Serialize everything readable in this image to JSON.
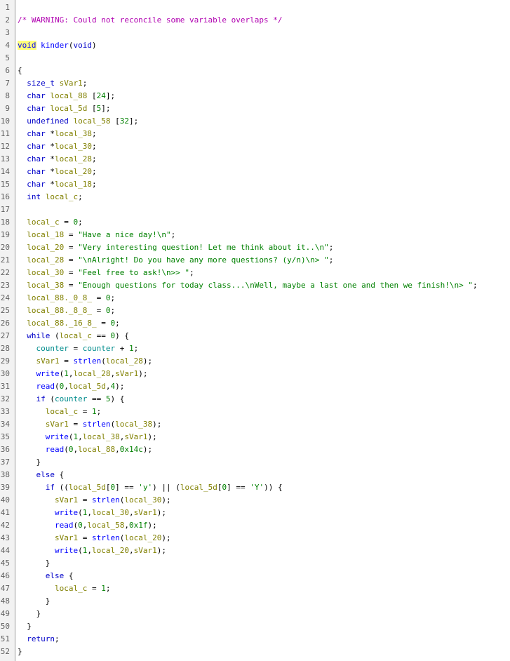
{
  "colors": {
    "comment": "#b000b0",
    "keyword": "#0000c8",
    "function": "#0000ff",
    "variable": "#808000",
    "global": "#008c8c",
    "string": "#008000",
    "highlight": "#ffff7a",
    "gutter_bg": "#f2f2f2",
    "line_number": "#5f5f5f"
  },
  "lines": [
    [],
    [
      [
        "cm",
        "/* WARNING: Could not reconcile some variable overlaps */"
      ]
    ],
    [],
    [
      [
        "fn-hl",
        "void"
      ],
      [
        "pn",
        " "
      ],
      [
        "fn",
        "kinder"
      ],
      [
        "pn",
        "("
      ],
      [
        "ty",
        "void"
      ],
      [
        "pn",
        ")"
      ]
    ],
    [],
    [
      [
        "pn",
        "{"
      ]
    ],
    [
      [
        "pn",
        "  "
      ],
      [
        "ty",
        "size_t"
      ],
      [
        "pn",
        " "
      ],
      [
        "var",
        "sVar1"
      ],
      [
        "pn",
        ";"
      ]
    ],
    [
      [
        "pn",
        "  "
      ],
      [
        "ty",
        "char"
      ],
      [
        "pn",
        " "
      ],
      [
        "var",
        "local_88"
      ],
      [
        "pn",
        " ["
      ],
      [
        "num",
        "24"
      ],
      [
        "pn",
        "];"
      ]
    ],
    [
      [
        "pn",
        "  "
      ],
      [
        "ty",
        "char"
      ],
      [
        "pn",
        " "
      ],
      [
        "var",
        "local_5d"
      ],
      [
        "pn",
        " ["
      ],
      [
        "num",
        "5"
      ],
      [
        "pn",
        "];"
      ]
    ],
    [
      [
        "pn",
        "  "
      ],
      [
        "ty",
        "undefined"
      ],
      [
        "pn",
        " "
      ],
      [
        "var",
        "local_58"
      ],
      [
        "pn",
        " ["
      ],
      [
        "num",
        "32"
      ],
      [
        "pn",
        "];"
      ]
    ],
    [
      [
        "pn",
        "  "
      ],
      [
        "ty",
        "char"
      ],
      [
        "pn",
        " *"
      ],
      [
        "var",
        "local_38"
      ],
      [
        "pn",
        ";"
      ]
    ],
    [
      [
        "pn",
        "  "
      ],
      [
        "ty",
        "char"
      ],
      [
        "pn",
        " *"
      ],
      [
        "var",
        "local_30"
      ],
      [
        "pn",
        ";"
      ]
    ],
    [
      [
        "pn",
        "  "
      ],
      [
        "ty",
        "char"
      ],
      [
        "pn",
        " *"
      ],
      [
        "var",
        "local_28"
      ],
      [
        "pn",
        ";"
      ]
    ],
    [
      [
        "pn",
        "  "
      ],
      [
        "ty",
        "char"
      ],
      [
        "pn",
        " *"
      ],
      [
        "var",
        "local_20"
      ],
      [
        "pn",
        ";"
      ]
    ],
    [
      [
        "pn",
        "  "
      ],
      [
        "ty",
        "char"
      ],
      [
        "pn",
        " *"
      ],
      [
        "var",
        "local_18"
      ],
      [
        "pn",
        ";"
      ]
    ],
    [
      [
        "pn",
        "  "
      ],
      [
        "ty",
        "int"
      ],
      [
        "pn",
        " "
      ],
      [
        "var",
        "local_c"
      ],
      [
        "pn",
        ";"
      ]
    ],
    [],
    [
      [
        "pn",
        "  "
      ],
      [
        "var",
        "local_c"
      ],
      [
        "pn",
        " = "
      ],
      [
        "num",
        "0"
      ],
      [
        "pn",
        ";"
      ]
    ],
    [
      [
        "pn",
        "  "
      ],
      [
        "var",
        "local_18"
      ],
      [
        "pn",
        " = "
      ],
      [
        "str",
        "\"Have a nice day!\\n\""
      ],
      [
        "pn",
        ";"
      ]
    ],
    [
      [
        "pn",
        "  "
      ],
      [
        "var",
        "local_20"
      ],
      [
        "pn",
        " = "
      ],
      [
        "str",
        "\"Very interesting question! Let me think about it..\\n\""
      ],
      [
        "pn",
        ";"
      ]
    ],
    [
      [
        "pn",
        "  "
      ],
      [
        "var",
        "local_28"
      ],
      [
        "pn",
        " = "
      ],
      [
        "str",
        "\"\\nAlright! Do you have any more questions? (y/n)\\n> \""
      ],
      [
        "pn",
        ";"
      ]
    ],
    [
      [
        "pn",
        "  "
      ],
      [
        "var",
        "local_30"
      ],
      [
        "pn",
        " = "
      ],
      [
        "str",
        "\"Feel free to ask!\\n>> \""
      ],
      [
        "pn",
        ";"
      ]
    ],
    [
      [
        "pn",
        "  "
      ],
      [
        "var",
        "local_38"
      ],
      [
        "pn",
        " = "
      ],
      [
        "str",
        "\"Enough questions for today class...\\nWell, maybe a last one and then we finish!\\n> \""
      ],
      [
        "pn",
        ";"
      ]
    ],
    [
      [
        "pn",
        "  "
      ],
      [
        "var",
        "local_88._0_8_"
      ],
      [
        "pn",
        " = "
      ],
      [
        "num",
        "0"
      ],
      [
        "pn",
        ";"
      ]
    ],
    [
      [
        "pn",
        "  "
      ],
      [
        "var",
        "local_88._8_8_"
      ],
      [
        "pn",
        " = "
      ],
      [
        "num",
        "0"
      ],
      [
        "pn",
        ";"
      ]
    ],
    [
      [
        "pn",
        "  "
      ],
      [
        "var",
        "local_88._16_8_"
      ],
      [
        "pn",
        " = "
      ],
      [
        "num",
        "0"
      ],
      [
        "pn",
        ";"
      ]
    ],
    [
      [
        "pn",
        "  "
      ],
      [
        "kw",
        "while"
      ],
      [
        "pn",
        " ("
      ],
      [
        "var",
        "local_c"
      ],
      [
        "pn",
        " == "
      ],
      [
        "num",
        "0"
      ],
      [
        "pn",
        ") {"
      ]
    ],
    [
      [
        "pn",
        "    "
      ],
      [
        "gl",
        "counter"
      ],
      [
        "pn",
        " = "
      ],
      [
        "gl",
        "counter"
      ],
      [
        "pn",
        " + "
      ],
      [
        "num",
        "1"
      ],
      [
        "pn",
        ";"
      ]
    ],
    [
      [
        "pn",
        "    "
      ],
      [
        "var",
        "sVar1"
      ],
      [
        "pn",
        " = "
      ],
      [
        "fn",
        "strlen"
      ],
      [
        "pn",
        "("
      ],
      [
        "var",
        "local_28"
      ],
      [
        "pn",
        ");"
      ]
    ],
    [
      [
        "pn",
        "    "
      ],
      [
        "fn",
        "write"
      ],
      [
        "pn",
        "("
      ],
      [
        "num",
        "1"
      ],
      [
        "pn",
        ","
      ],
      [
        "var",
        "local_28"
      ],
      [
        "pn",
        ","
      ],
      [
        "var",
        "sVar1"
      ],
      [
        "pn",
        ");"
      ]
    ],
    [
      [
        "pn",
        "    "
      ],
      [
        "fn",
        "read"
      ],
      [
        "pn",
        "("
      ],
      [
        "num",
        "0"
      ],
      [
        "pn",
        ","
      ],
      [
        "var",
        "local_5d"
      ],
      [
        "pn",
        ","
      ],
      [
        "num",
        "4"
      ],
      [
        "pn",
        ");"
      ]
    ],
    [
      [
        "pn",
        "    "
      ],
      [
        "kw",
        "if"
      ],
      [
        "pn",
        " ("
      ],
      [
        "gl",
        "counter"
      ],
      [
        "pn",
        " == "
      ],
      [
        "num",
        "5"
      ],
      [
        "pn",
        ") {"
      ]
    ],
    [
      [
        "pn",
        "      "
      ],
      [
        "var",
        "local_c"
      ],
      [
        "pn",
        " = "
      ],
      [
        "num",
        "1"
      ],
      [
        "pn",
        ";"
      ]
    ],
    [
      [
        "pn",
        "      "
      ],
      [
        "var",
        "sVar1"
      ],
      [
        "pn",
        " = "
      ],
      [
        "fn",
        "strlen"
      ],
      [
        "pn",
        "("
      ],
      [
        "var",
        "local_38"
      ],
      [
        "pn",
        ");"
      ]
    ],
    [
      [
        "pn",
        "      "
      ],
      [
        "fn",
        "write"
      ],
      [
        "pn",
        "("
      ],
      [
        "num",
        "1"
      ],
      [
        "pn",
        ","
      ],
      [
        "var",
        "local_38"
      ],
      [
        "pn",
        ","
      ],
      [
        "var",
        "sVar1"
      ],
      [
        "pn",
        ");"
      ]
    ],
    [
      [
        "pn",
        "      "
      ],
      [
        "fn",
        "read"
      ],
      [
        "pn",
        "("
      ],
      [
        "num",
        "0"
      ],
      [
        "pn",
        ","
      ],
      [
        "var",
        "local_88"
      ],
      [
        "pn",
        ","
      ],
      [
        "num",
        "0x14c"
      ],
      [
        "pn",
        ");"
      ]
    ],
    [
      [
        "pn",
        "    }"
      ]
    ],
    [
      [
        "pn",
        "    "
      ],
      [
        "kw",
        "else"
      ],
      [
        "pn",
        " {"
      ]
    ],
    [
      [
        "pn",
        "      "
      ],
      [
        "kw",
        "if"
      ],
      [
        "pn",
        " (("
      ],
      [
        "var",
        "local_5d"
      ],
      [
        "pn",
        "["
      ],
      [
        "num",
        "0"
      ],
      [
        "pn",
        "] == "
      ],
      [
        "str",
        "'y'"
      ],
      [
        "pn",
        ") || ("
      ],
      [
        "var",
        "local_5d"
      ],
      [
        "pn",
        "["
      ],
      [
        "num",
        "0"
      ],
      [
        "pn",
        "] == "
      ],
      [
        "str",
        "'Y'"
      ],
      [
        "pn",
        ")) {"
      ]
    ],
    [
      [
        "pn",
        "        "
      ],
      [
        "var",
        "sVar1"
      ],
      [
        "pn",
        " = "
      ],
      [
        "fn",
        "strlen"
      ],
      [
        "pn",
        "("
      ],
      [
        "var",
        "local_30"
      ],
      [
        "pn",
        ");"
      ]
    ],
    [
      [
        "pn",
        "        "
      ],
      [
        "fn",
        "write"
      ],
      [
        "pn",
        "("
      ],
      [
        "num",
        "1"
      ],
      [
        "pn",
        ","
      ],
      [
        "var",
        "local_30"
      ],
      [
        "pn",
        ","
      ],
      [
        "var",
        "sVar1"
      ],
      [
        "pn",
        ");"
      ]
    ],
    [
      [
        "pn",
        "        "
      ],
      [
        "fn",
        "read"
      ],
      [
        "pn",
        "("
      ],
      [
        "num",
        "0"
      ],
      [
        "pn",
        ","
      ],
      [
        "var",
        "local_58"
      ],
      [
        "pn",
        ","
      ],
      [
        "num",
        "0x1f"
      ],
      [
        "pn",
        ");"
      ]
    ],
    [
      [
        "pn",
        "        "
      ],
      [
        "var",
        "sVar1"
      ],
      [
        "pn",
        " = "
      ],
      [
        "fn",
        "strlen"
      ],
      [
        "pn",
        "("
      ],
      [
        "var",
        "local_20"
      ],
      [
        "pn",
        ");"
      ]
    ],
    [
      [
        "pn",
        "        "
      ],
      [
        "fn",
        "write"
      ],
      [
        "pn",
        "("
      ],
      [
        "num",
        "1"
      ],
      [
        "pn",
        ","
      ],
      [
        "var",
        "local_20"
      ],
      [
        "pn",
        ","
      ],
      [
        "var",
        "sVar1"
      ],
      [
        "pn",
        ");"
      ]
    ],
    [
      [
        "pn",
        "      }"
      ]
    ],
    [
      [
        "pn",
        "      "
      ],
      [
        "kw",
        "else"
      ],
      [
        "pn",
        " {"
      ]
    ],
    [
      [
        "pn",
        "        "
      ],
      [
        "var",
        "local_c"
      ],
      [
        "pn",
        " = "
      ],
      [
        "num",
        "1"
      ],
      [
        "pn",
        ";"
      ]
    ],
    [
      [
        "pn",
        "      }"
      ]
    ],
    [
      [
        "pn",
        "    }"
      ]
    ],
    [
      [
        "pn",
        "  }"
      ]
    ],
    [
      [
        "pn",
        "  "
      ],
      [
        "kw",
        "return"
      ],
      [
        "pn",
        ";"
      ]
    ],
    [
      [
        "pn",
        "}"
      ]
    ]
  ]
}
